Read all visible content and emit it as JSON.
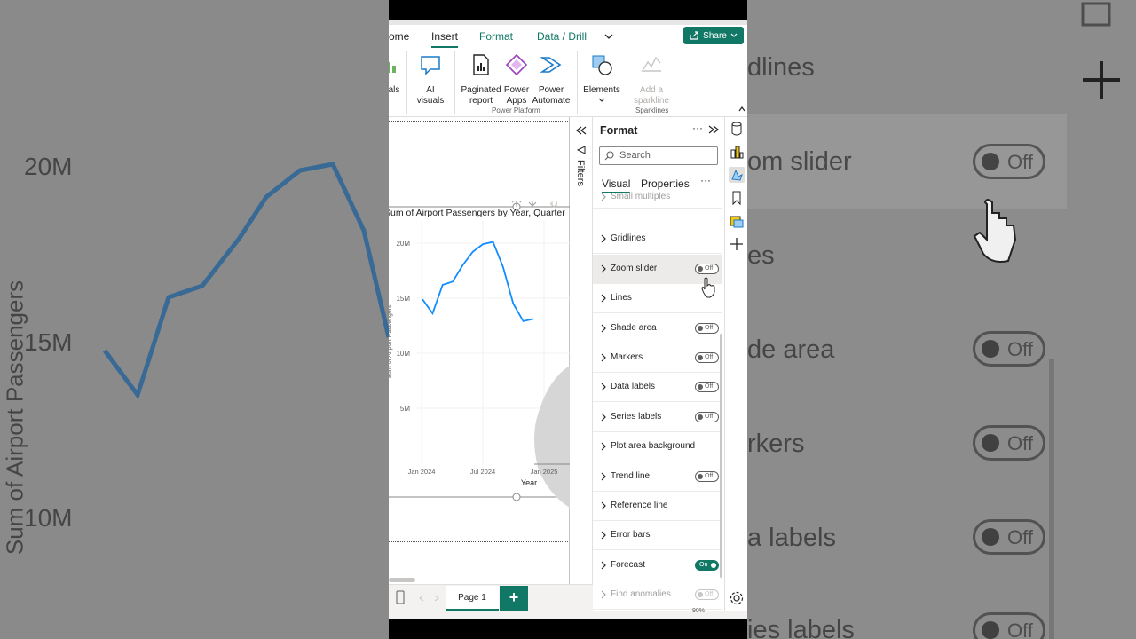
{
  "background_zoom": {
    "left_y_ticks": [
      "20M",
      "15M",
      "10M"
    ],
    "left_axis_label": "Sum of Airport Passengers",
    "right_labels": [
      "dlines",
      "om slider",
      "es",
      "de area",
      "rkers",
      "a labels",
      "ies labels"
    ],
    "toggle_text": "Off"
  },
  "tabs": {
    "home": "ome",
    "insert": "Insert",
    "format": "Format",
    "data_drill": "Data / Drill",
    "share": "Share"
  },
  "ribbon": {
    "visuals_label": "als",
    "ai_visuals": "AI visuals",
    "paginated_report": "Paginated report",
    "power_apps": "Power Apps",
    "power_automate": "Power Automate",
    "power_platform_group": "Power Platform",
    "elements": "Elements",
    "add_sparkline": "Add a sparkline",
    "sparklines_group": "Sparklines"
  },
  "chart": {
    "title": "Sum of Airport Passengers by Year, Quarter",
    "ylabel": "Sum of Airport Passengers",
    "xlabel": "Year",
    "yticks": [
      "20M",
      "15M",
      "10M",
      "5M"
    ],
    "xticks": [
      "Jan 2024",
      "Jul 2024",
      "Jan 2025"
    ]
  },
  "chart_data": {
    "type": "line",
    "title": "Sum of Airport Passengers by Year, Quarter",
    "xlabel": "Year",
    "ylabel": "Sum of Airport Passengers",
    "ylim": [
      0,
      22000000
    ],
    "series": [
      {
        "values": [
          14900000,
          13600000,
          16200000,
          16500000,
          18000000,
          19200000,
          19900000,
          20100000,
          17800000,
          14500000,
          12900000,
          13100000
        ]
      }
    ],
    "forecast_band": true,
    "grid": true
  },
  "filters": {
    "label": "Filters"
  },
  "format_pane": {
    "title": "Format",
    "search_placeholder": "Search",
    "tab_visual": "Visual",
    "tab_properties": "Properties",
    "rows": [
      {
        "label": "Small multiples",
        "toggle": null,
        "dim": true
      },
      {
        "label": "Gridlines",
        "toggle": null
      },
      {
        "label": "Zoom slider",
        "toggle": "Off"
      },
      {
        "label": "Lines",
        "toggle": null
      },
      {
        "label": "Shade area",
        "toggle": "Off"
      },
      {
        "label": "Markers",
        "toggle": "Off"
      },
      {
        "label": "Data labels",
        "toggle": "Off"
      },
      {
        "label": "Series labels",
        "toggle": "Off"
      },
      {
        "label": "Plot area background",
        "toggle": null
      },
      {
        "label": "Trend line",
        "toggle": "Off"
      },
      {
        "label": "Reference line",
        "toggle": null
      },
      {
        "label": "Error bars",
        "toggle": null
      },
      {
        "label": "Forecast",
        "toggle": "On"
      },
      {
        "label": "Find anomalies",
        "toggle": "Off",
        "dim": true
      }
    ]
  },
  "pagebar": {
    "page1": "Page 1",
    "zoom": "90%"
  },
  "colors": {
    "accent": "#117865",
    "line": "#118dff"
  }
}
